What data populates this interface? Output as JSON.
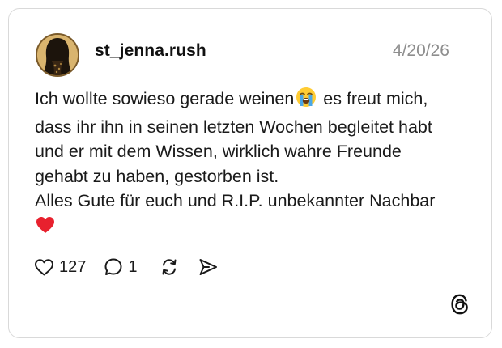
{
  "post": {
    "username": "st_jenna.rush",
    "date": "4/20/26",
    "lines": [
      "Ich wollte sowieso gerade weinen",
      "es freut mich,",
      "dass ihr ihn in seinen letzten Wochen begleitet habt",
      "und er mit dem Wissen, wirklich wahre Freunde",
      "gehabt zu haben, gestorben ist.",
      "Alles Gute für euch und R.I.P. unbekannter Nachbar"
    ],
    "emojis": {
      "inline": "loudly-crying-face-emoji",
      "end": "red-heart-emoji"
    }
  },
  "actions": {
    "like_icon": "heart-outline-icon",
    "like_count": "127",
    "reply_icon": "speech-bubble-icon",
    "reply_count": "1",
    "repost_icon": "repost-icon",
    "share_icon": "send-arrow-icon"
  },
  "branding": {
    "logo": "threads-logo-icon"
  },
  "colors": {
    "text": "#1a1a1a",
    "muted": "#8e8e8e",
    "border": "#d9d9d9",
    "heart": "#e8212e"
  }
}
